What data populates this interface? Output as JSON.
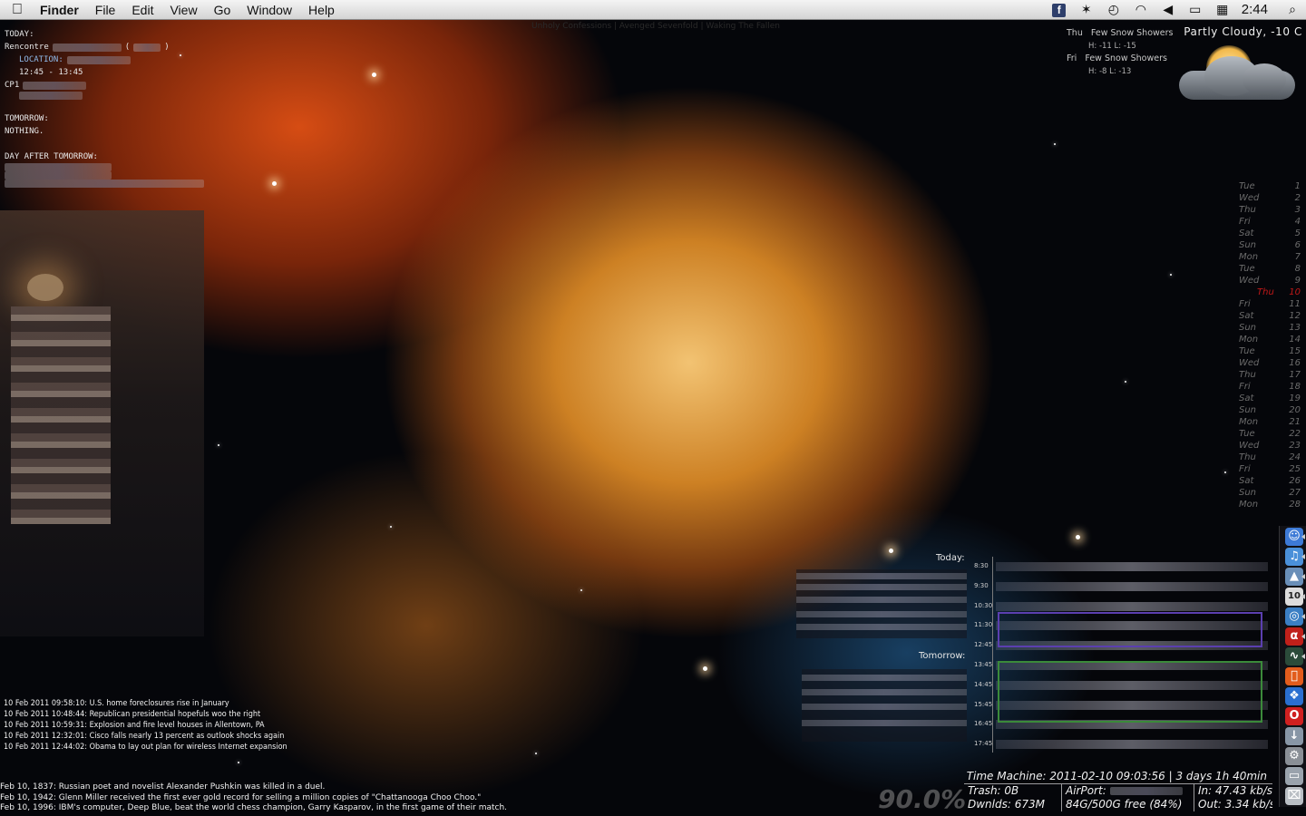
{
  "menubar": {
    "app_name": "Finder",
    "menus": [
      "File",
      "Edit",
      "View",
      "Go",
      "Window",
      "Help"
    ],
    "clock": "2:44"
  },
  "now_playing": "Unholy Confessions | Avenged Sevenfold | Waking The Fallen",
  "agenda": {
    "today_label": "TODAY:",
    "event_title": "Rencontre",
    "location_label": "LOCATION:",
    "time": "12:45 - 13:45",
    "second_event": "CP1",
    "tomorrow_label": "TOMORROW:",
    "tomorrow_value": "NOTHING.",
    "day_after_label": "DAY AFTER TOMORROW:"
  },
  "weather": {
    "condition": "Partly Cloudy, -10 C",
    "forecast": [
      {
        "day": "Thu",
        "text": "Few Snow Showers",
        "hl": "H: -11  L: -15"
      },
      {
        "day": "Fri",
        "text": "Few Snow Showers",
        "hl": "H: -8  L: -13"
      }
    ]
  },
  "calendar": [
    {
      "day": "Tue",
      "n": "1"
    },
    {
      "day": "Wed",
      "n": "2"
    },
    {
      "day": "Thu",
      "n": "3"
    },
    {
      "day": "Fri",
      "n": "4"
    },
    {
      "day": "Sat",
      "n": "5"
    },
    {
      "day": "Sun",
      "n": "6"
    },
    {
      "day": "Mon",
      "n": "7"
    },
    {
      "day": "Tue",
      "n": "8"
    },
    {
      "day": "Wed",
      "n": "9"
    },
    {
      "day": "Thu",
      "n": "10",
      "today": true
    },
    {
      "day": "Fri",
      "n": "11"
    },
    {
      "day": "Sat",
      "n": "12"
    },
    {
      "day": "Sun",
      "n": "13"
    },
    {
      "day": "Mon",
      "n": "14"
    },
    {
      "day": "Tue",
      "n": "15"
    },
    {
      "day": "Wed",
      "n": "16"
    },
    {
      "day": "Thu",
      "n": "17"
    },
    {
      "day": "Fri",
      "n": "18"
    },
    {
      "day": "Sat",
      "n": "19"
    },
    {
      "day": "Sun",
      "n": "20"
    },
    {
      "day": "Mon",
      "n": "21"
    },
    {
      "day": "Tue",
      "n": "22"
    },
    {
      "day": "Wed",
      "n": "23"
    },
    {
      "day": "Thu",
      "n": "24"
    },
    {
      "day": "Fri",
      "n": "25"
    },
    {
      "day": "Sat",
      "n": "26"
    },
    {
      "day": "Sun",
      "n": "27"
    },
    {
      "day": "Mon",
      "n": "28"
    }
  ],
  "news": [
    "10 Feb 2011 09:58:10: U.S. home foreclosures rise in January",
    "10 Feb 2011 10:48:44: Republican presidential hopefuls woo the right",
    "10 Feb 2011 10:59:31: Explosion and fire level houses in Allentown, PA",
    "10 Feb 2011 12:32:01: Cisco falls nearly 13 percent as outlook shocks again",
    "10 Feb 2011 12:44:02: Obama to lay out plan for wireless Internet expansion"
  ],
  "history": [
    "Feb 10, 1837: Russian poet and novelist Alexander Pushkin was killed in a duel.",
    "Feb 10, 1942: Glenn Miller received the first ever gold record for selling a million copies of \"Chattanooga Choo Choo.\"",
    "Feb 10, 1996: IBM's computer, Deep Blue, beat the world chess champion, Garry Kasparov, in the first game of their match."
  ],
  "events": {
    "today_label": "Today:",
    "tomorrow_label": "Tomorrow:"
  },
  "timeline": {
    "hours": [
      "8:30",
      "9:30",
      "10:30",
      "11:30",
      "12:45",
      "13:45",
      "14:45",
      "15:45",
      "16:45",
      "17:45"
    ],
    "block_colors": [
      "#5b3fb0",
      "#3b8a3a"
    ]
  },
  "stats": {
    "percent": "90.0%",
    "time_machine": "Time Machine: 2011-02-10 09:03:56 | 3 days 1h 40min",
    "trash": "Trash: 0B",
    "downloads": "Dwnlds: 673M",
    "airport": "AirPort:",
    "disk": "84G/500G free (84%)",
    "net_in": "In: 47.43 kb/s",
    "net_out": "Out: 3.34 kb/s"
  },
  "dock": [
    "finder-icon",
    "itunes-icon",
    "preview-icon",
    "ical-icon",
    "safari-icon",
    "acrobat-icon",
    "activity-monitor-icon",
    "apple-icon",
    "windows-icon",
    "opera-icon",
    "downloads-icon",
    "system-prefs-icon",
    "imac-icon",
    "trash-icon"
  ]
}
